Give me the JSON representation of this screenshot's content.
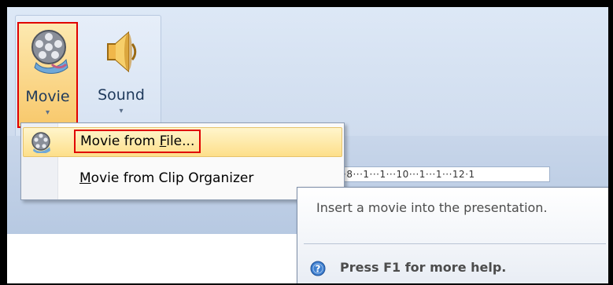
{
  "ribbon": {
    "movie_label": "Movie",
    "sound_label": "Sound",
    "dropdown_arrow": "▾"
  },
  "menu": {
    "items": [
      {
        "prefix": "Movie from ",
        "accel": "F",
        "suffix": "ile...",
        "icon": "film-reel-icon"
      },
      {
        "prefix": "",
        "accel": "M",
        "suffix": "ovie from Clip Organizer",
        "icon": ""
      }
    ]
  },
  "ruler": {
    "text": "·8···1···1···10···1···1···12·1"
  },
  "tooltip": {
    "description": "Insert a movie into the presentation.",
    "help": "Press F1 for more help.",
    "help_icon": "help-question-icon"
  },
  "colors": {
    "highlight_border": "#e00000",
    "menu_hover": "#fddf8a",
    "ribbon_text": "#1e395b"
  }
}
